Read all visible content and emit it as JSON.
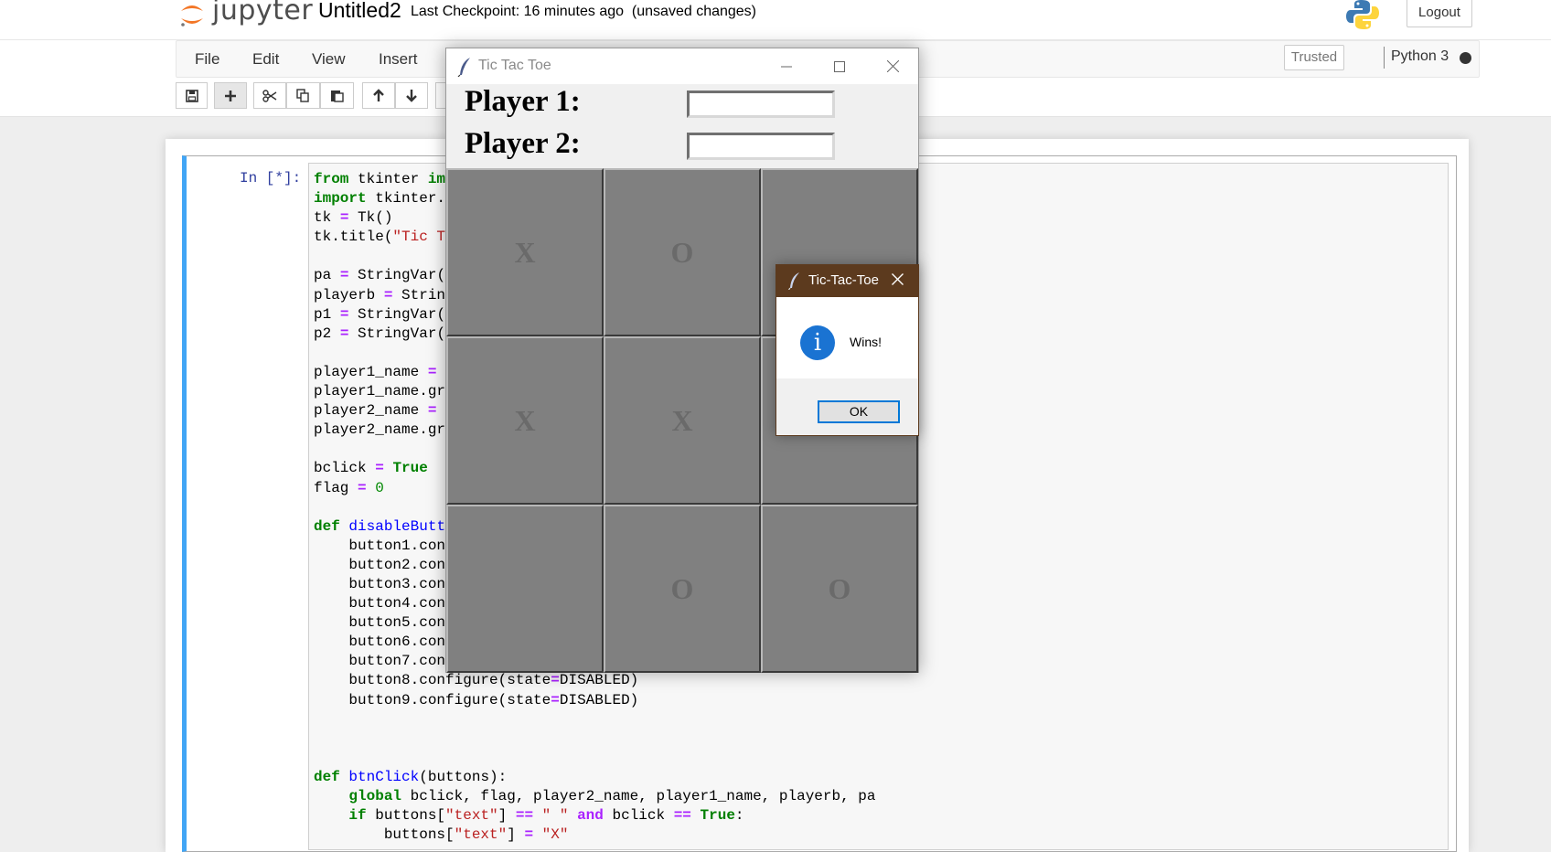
{
  "header": {
    "logo_text": "jupyter",
    "notebook_title": "Untitled2",
    "checkpoint": "Last Checkpoint: 16 minutes ago",
    "unsaved": "(unsaved changes)",
    "logout_label": "Logout"
  },
  "menu": [
    "File",
    "Edit",
    "View",
    "Insert"
  ],
  "kernel": {
    "trusted_label": "Trusted",
    "name": "Python 3"
  },
  "toolbar": {
    "icons": [
      "save-icon",
      "plus-icon",
      "cut-icon",
      "copy-icon",
      "paste-icon",
      "arrow-up-icon",
      "arrow-down-icon"
    ]
  },
  "cell": {
    "prompt": "In [*]:"
  },
  "ttt_window": {
    "title": "Tic Tac Toe",
    "player1_label": "Player 1:",
    "player2_label": "Player 2:",
    "player1_value": "",
    "player2_value": "",
    "board": [
      "X",
      "O",
      "",
      "X",
      "X",
      "",
      "",
      "O",
      "O"
    ]
  },
  "msgbox": {
    "title": "Tic-Tac-Toe",
    "message": "Wins!",
    "ok_label": "OK"
  },
  "colors": {
    "cell_accent": "#42a5f5",
    "msg_titlebar": "#5c3a1e",
    "ok_border": "#0078d7",
    "info_icon": "#1a73d2"
  }
}
